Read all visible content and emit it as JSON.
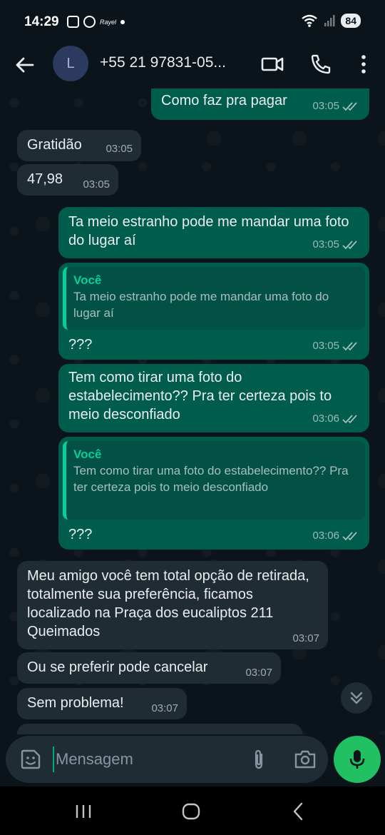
{
  "status_bar": {
    "time": "14:29",
    "small_label": "Rayel",
    "battery": "84"
  },
  "header": {
    "avatar_letter": "L",
    "contact": "+55 21 97831-05..."
  },
  "messages": [
    {
      "direction": "out",
      "text": "Como faz pra pagar",
      "time": "03:05"
    },
    {
      "direction": "in",
      "text": "Gratidão",
      "time": "03:05"
    },
    {
      "direction": "in",
      "text": "47,98",
      "time": "03:05"
    },
    {
      "direction": "out",
      "text": "Ta meio estranho pode me mandar uma foto do lugar aí",
      "time": "03:05"
    },
    {
      "direction": "out",
      "quote_author": "Você",
      "quote_text": "Ta meio estranho pode me mandar uma foto do lugar aí",
      "text": "???",
      "time": "03:05"
    },
    {
      "direction": "out",
      "text": "Tem como tirar uma foto do estabelecimento?? Pra ter certeza pois to meio desconfiado",
      "time": "03:06"
    },
    {
      "direction": "out",
      "quote_author": "Você",
      "quote_text": "Tem como tirar uma foto do estabelecimento?? Pra ter certeza pois to meio desconfiado",
      "text": "???",
      "time": "03:06"
    },
    {
      "direction": "in",
      "text": "Meu amigo você tem total opção de retirada, totalmente sua preferência, ficamos localizado na Praça dos eucaliptos 211 Queimados",
      "time": "03:07"
    },
    {
      "direction": "in",
      "text": "Ou se preferir pode cancelar",
      "time": "03:07"
    },
    {
      "direction": "in",
      "text": "Sem problema!",
      "time": "03:07"
    }
  ],
  "input": {
    "placeholder": "Mensagem"
  },
  "colors": {
    "background": "#0b141a",
    "incoming_bubble": "#202c33",
    "outgoing_bubble": "#005c4b",
    "accent": "#00a884",
    "mic_button": "#21c063",
    "quote_bar": "#06cf9c"
  },
  "icons": [
    "back-arrow-icon",
    "video-call-icon",
    "phone-icon",
    "more-vert-icon",
    "read-ticks-icon",
    "chevron-double-down-icon",
    "sticker-icon",
    "attach-icon",
    "camera-icon",
    "mic-icon",
    "recents-icon",
    "home-icon",
    "nav-back-icon"
  ]
}
